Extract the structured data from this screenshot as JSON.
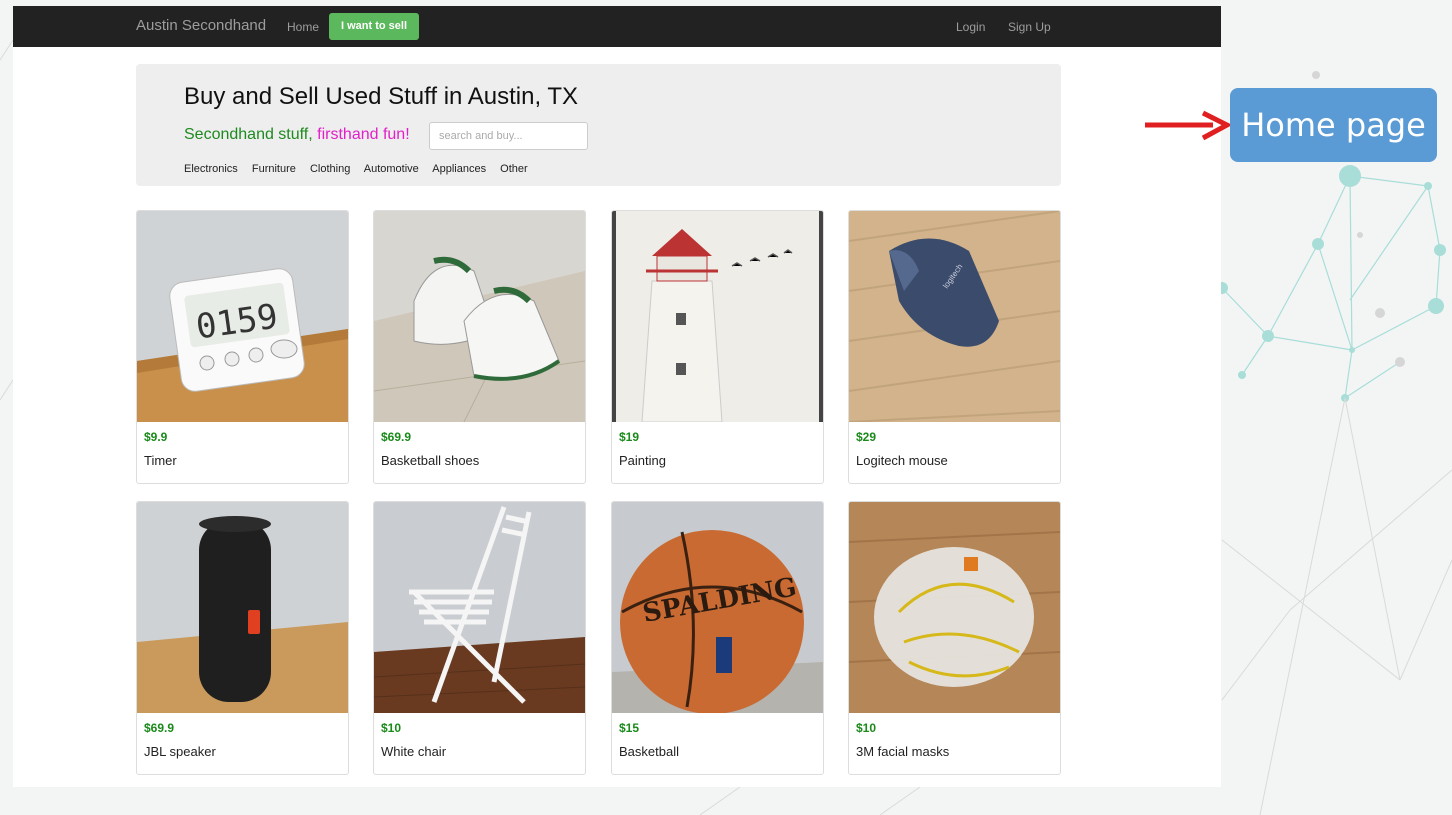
{
  "navbar": {
    "brand": "Austin Secondhand",
    "home": "Home",
    "sell_button": "I want to sell",
    "login": "Login",
    "signup": "Sign Up"
  },
  "hero": {
    "title": "Buy and Sell Used Stuff in Austin, TX",
    "tagline_part1": "Secondhand stuff, ",
    "tagline_part2": "firsthand fun!",
    "search_placeholder": "search and buy...",
    "categories": [
      "Electronics",
      "Furniture",
      "Clothing",
      "Automotive",
      "Appliances",
      "Other"
    ]
  },
  "products": [
    {
      "price": "$9.9",
      "title": "Timer",
      "icon": "timer-image"
    },
    {
      "price": "$69.9",
      "title": "Basketball shoes",
      "icon": "shoes-image"
    },
    {
      "price": "$19",
      "title": "Painting",
      "icon": "painting-image"
    },
    {
      "price": "$29",
      "title": "Logitech mouse",
      "icon": "mouse-image"
    },
    {
      "price": "$69.9",
      "title": "JBL speaker",
      "icon": "speaker-image"
    },
    {
      "price": "$10",
      "title": "White chair",
      "icon": "chair-image"
    },
    {
      "price": "$15",
      "title": "Basketball",
      "icon": "basketball-image"
    },
    {
      "price": "$10",
      "title": "3M facial masks",
      "icon": "masks-image"
    }
  ],
  "annotation": {
    "label": "Home page",
    "color": "#5b9bd5",
    "arrow_color": "#e02020"
  },
  "colors": {
    "navbar": "#222222",
    "sell_button": "#5cb85c",
    "price": "#1a8a1a",
    "tagline_green": "#1e8a1e",
    "tagline_pink": "#e020c8"
  }
}
